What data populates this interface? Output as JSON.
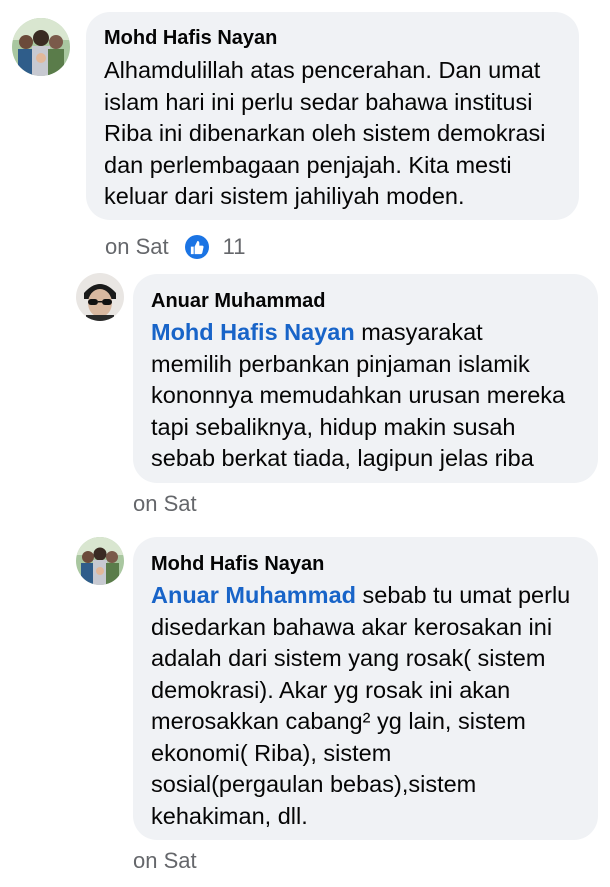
{
  "comments": [
    {
      "author": "Mohd Hafis Nayan",
      "mention": "",
      "text": "Alhamdulillah atas pencerahan. Dan umat\nislam hari ini perlu sedar bahawa institusi\nRiba ini dibenarkan oleh sistem demokrasi\ndan perlembagaan penjajah. Kita mesti\nkeluar dari sistem jahiliyah moden.",
      "time": "on Sat",
      "like_count": "11",
      "avatar_icon": "family-avatar-icon"
    },
    {
      "author": "Anuar Muhammad",
      "mention": "Mohd Hafis Nayan",
      "text": " masyarakat\nmemilih perbankan pinjaman islamik\nkononnya memudahkan urusan mereka\ntapi sebaliknya, hidup makin susah\nsebab berkat tiada, lagipun jelas riba",
      "time": "on Sat",
      "avatar_icon": "sunglasses-avatar-icon"
    },
    {
      "author": "Mohd Hafis Nayan",
      "mention": "Anuar Muhammad",
      "text": " sebab tu umat perlu\ndisedarkan bahawa akar kerosakan ini\nadalah dari sistem yang rosak( sistem\ndemokrasi). Akar yg rosak ini akan\nmerosakkan cabang² yg lain, sistem\nekonomi( Riba), sistem\nsosial(pergaulan bebas),sistem\nkehakiman, dll.",
      "time": "on Sat",
      "avatar_icon": "family-avatar-icon"
    }
  ],
  "colors": {
    "bubble": "#f0f2f5",
    "mention": "#1864c8",
    "meta": "#65676b",
    "like": "#1b74e4"
  }
}
